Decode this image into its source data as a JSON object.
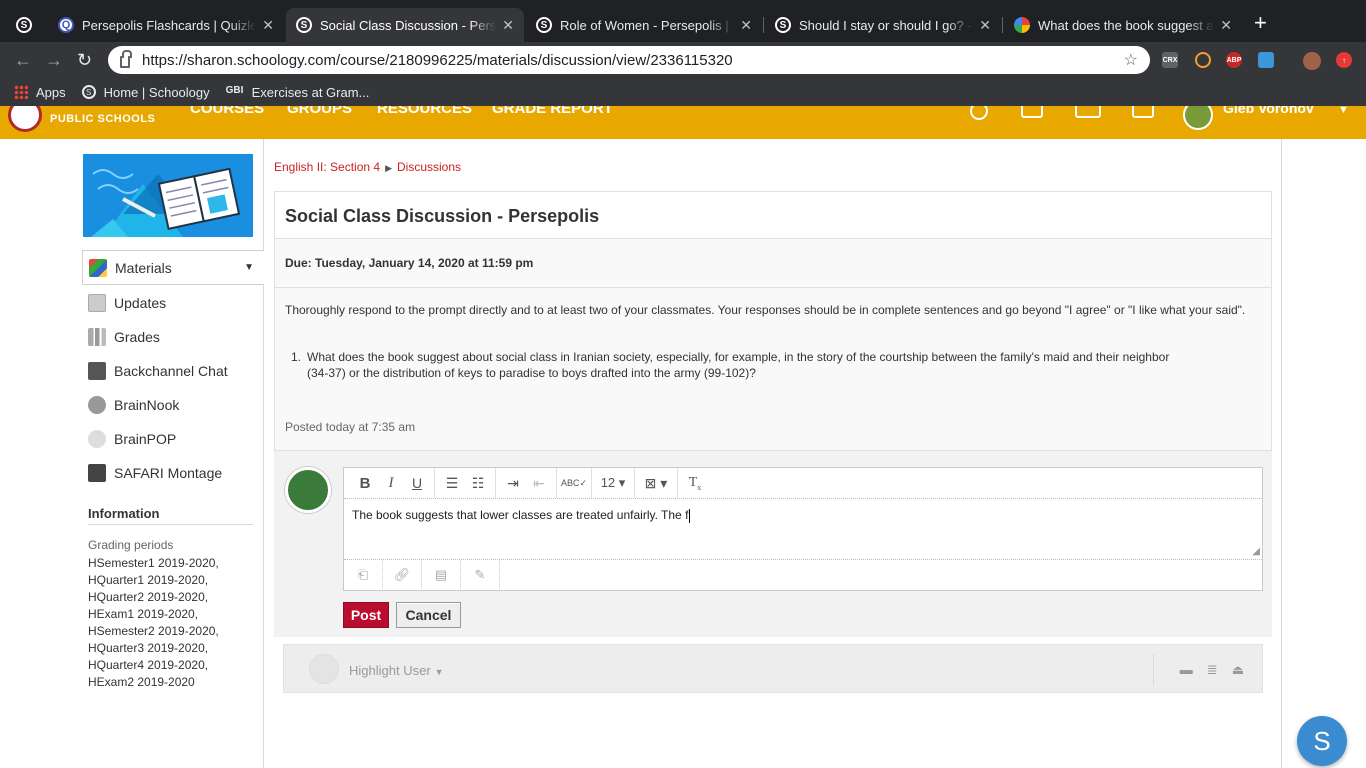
{
  "browser": {
    "tabs": [
      {
        "title": "Persepolis Flashcards | Quizlet",
        "favicon": "quizlet-icon"
      },
      {
        "title": "Social Class Discussion - Persepolis",
        "favicon": "schoology-icon",
        "active": true
      },
      {
        "title": "Role of Women - Persepolis | Schoology",
        "favicon": "schoology-icon"
      },
      {
        "title": "Should I stay or should I go? - Persepolis",
        "favicon": "schoology-icon"
      },
      {
        "title": "What does the book suggest about social class",
        "favicon": "google-icon"
      }
    ],
    "url": "https://sharon.schoology.com/course/2180996225/materials/discussion/view/2336115320",
    "extensions": [
      "CRX",
      "ABP"
    ],
    "bookmarks": [
      {
        "label": "Apps",
        "icon": "apps-grid-icon"
      },
      {
        "label": "Home | Schoology",
        "icon": "schoology-icon"
      },
      {
        "label": "Exercises at Gram...",
        "icon": "gbi-icon"
      }
    ]
  },
  "header": {
    "org_name": "PUBLIC SCHOOLS",
    "nav": [
      "COURSES",
      "GROUPS",
      "RESOURCES",
      "GRADE REPORT"
    ],
    "user_name": "Gleb Voronov",
    "color": "#e8a800"
  },
  "sidebar": {
    "items": [
      {
        "label": "Materials",
        "icon": "materials-icon",
        "active": true
      },
      {
        "label": "Updates",
        "icon": "updates-icon"
      },
      {
        "label": "Grades",
        "icon": "grades-icon"
      },
      {
        "label": "Backchannel Chat",
        "icon": "chat-icon"
      },
      {
        "label": "BrainNook",
        "icon": "brainnook-icon"
      },
      {
        "label": "BrainPOP",
        "icon": "brainpop-icon"
      },
      {
        "label": "SAFARI Montage",
        "icon": "safari-montage-icon"
      }
    ],
    "info_heading": "Information",
    "grading_label": "Grading periods",
    "periods": [
      "HSemester1 2019-2020,",
      "HQuarter1 2019-2020,",
      "HQuarter2 2019-2020,",
      "HExam1 2019-2020,",
      "HSemester2 2019-2020,",
      "HQuarter3 2019-2020,",
      "HQuarter4 2019-2020,",
      "HExam2 2019-2020"
    ]
  },
  "breadcrumb": {
    "course": "English II: Section 4",
    "section": "Discussions"
  },
  "discussion": {
    "title": "Social Class Discussion - Persepolis",
    "due": "Due: Tuesday, January 14, 2020 at 11:59 pm",
    "prompt": "Thoroughly respond to the prompt directly and to at least two of your classmates. Your responses should be in complete sentences and go beyond \"I agree\" or \"I like what your said\".",
    "question_number": "1.",
    "question": "What does the book suggest about social class in Iranian society, especially, for example, in the story of the courtship between the family's maid and their neighbor (34-37) or the distribution of keys to paradise to boys drafted into the army (99-102)?",
    "posted": "Posted today at 7:35 am"
  },
  "editor": {
    "font_size": "12",
    "text": "The book suggests that lower classes are treated unfairly. The f",
    "post_label": "Post",
    "cancel_label": "Cancel",
    "post_color": "#ba0c2f"
  },
  "highlight": {
    "label": "Highlight User"
  },
  "fab": {
    "label": "S"
  }
}
